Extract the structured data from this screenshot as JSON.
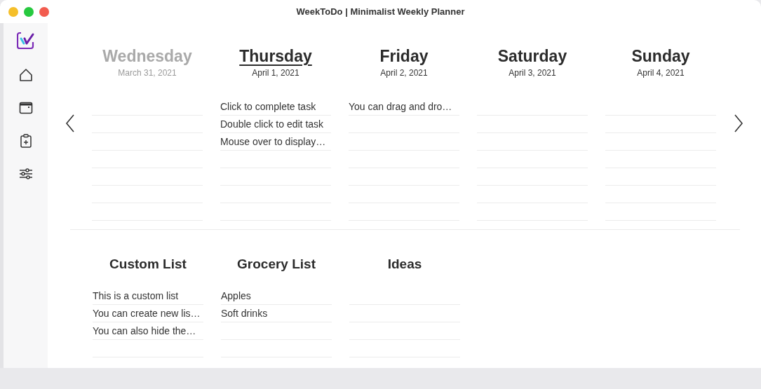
{
  "window": {
    "title": "WeekToDo | Minimalist Weekly Planner"
  },
  "days": [
    {
      "name": "Wednesday",
      "date": "March 31, 2021",
      "past": true,
      "today": false
    },
    {
      "name": "Thursday",
      "date": "April 1, 2021",
      "past": false,
      "today": true,
      "tasks": [
        "Click to complete task",
        "Double click to edit task",
        "Mouse over to display…"
      ]
    },
    {
      "name": "Friday",
      "date": "April 2, 2021",
      "past": false,
      "today": false,
      "tasks": [
        "You can drag and dro…"
      ]
    },
    {
      "name": "Saturday",
      "date": "April 3, 2021",
      "past": false,
      "today": false
    },
    {
      "name": "Sunday",
      "date": "April 4, 2021",
      "past": false,
      "today": false
    }
  ],
  "lists": [
    {
      "name": "Custom List",
      "items": [
        "This is a custom list",
        "You can create new lis…",
        "You can also hide the…"
      ]
    },
    {
      "name": "Grocery List",
      "items": [
        "Apples",
        "Soft drinks"
      ]
    },
    {
      "name": "Ideas"
    }
  ]
}
